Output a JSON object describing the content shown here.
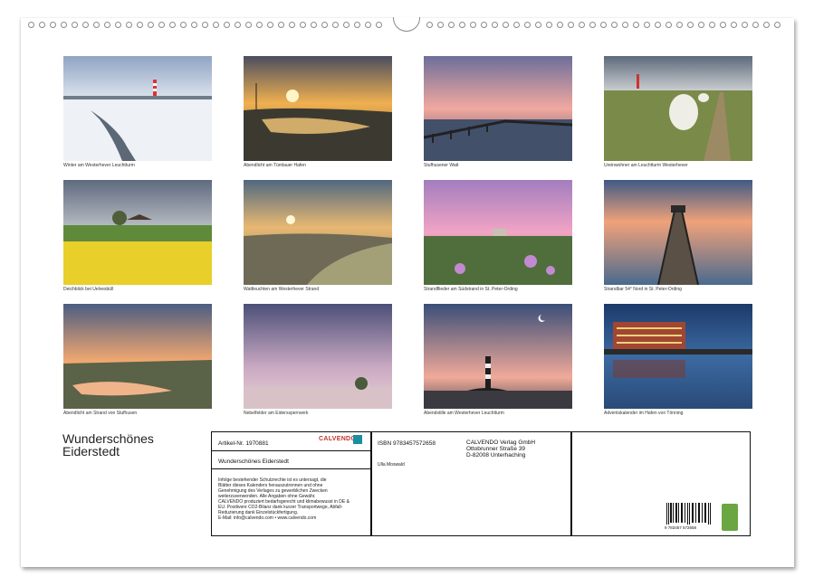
{
  "photos": [
    {
      "caption": "Winter am Westerhever Leuchtturm"
    },
    {
      "caption": "Abendlicht am Tümlauer Hafen"
    },
    {
      "caption": "Stufhusener Watt"
    },
    {
      "caption": "Ureinwohner am Leuchtturm Westerhever"
    },
    {
      "caption": "Deichblick bei Uelvesbüll"
    },
    {
      "caption": "Wattleuchten am Westerhever Strand"
    },
    {
      "caption": "Strandflieder am Südstrand in St. Peter-Ording"
    },
    {
      "caption": "Strandbar 54° Nord in St. Peter-Ording"
    },
    {
      "caption": "Abendlicht am Strand von Stufhusen"
    },
    {
      "caption": "Nebelfelder am Eiderssperrwerk"
    },
    {
      "caption": "Abendstille am Westerhever Leuchtturm"
    },
    {
      "caption": "Adventskalender im Hafen von Tönning"
    }
  ],
  "calendar_title_line1": "Wunderschönes",
  "calendar_title_line2": "Eiderstedt",
  "info": {
    "article_no": "Artikel-Nr. 1970881",
    "logo": "CALVENDO",
    "title": "Wunderschönes Eiderstedt",
    "legal": [
      "Infolge bestehender Schutzrechte ist es untersagt, die",
      "Blätter dieses Kalenders herauszutrennen und ohne",
      "Genehmigung des Verlages zu gewerblichen Zwecken",
      "weiterzuverwenden. Alle Angaben ohne Gewähr.",
      "CALVENDO produziert bedarfsgerecht und klimabewusst in DE &",
      "EU. Positivere CO2-Bilanz dank kurzer Transportwege, Abfall-",
      "Reduzierung dank Einzelstückfertigung.",
      "E-Mail: info@calvendo.com • www.calvendo.com"
    ],
    "isbn": "ISBN 9783457572658",
    "author": "Ulla Moswald",
    "publisher_line1": "CALVENDO Verlag GmbH",
    "publisher_line2": "Ottobrunner Straße 39",
    "publisher_line3": "D-82008 Unterhaching",
    "barcode_digits": "9 783457 572658"
  }
}
